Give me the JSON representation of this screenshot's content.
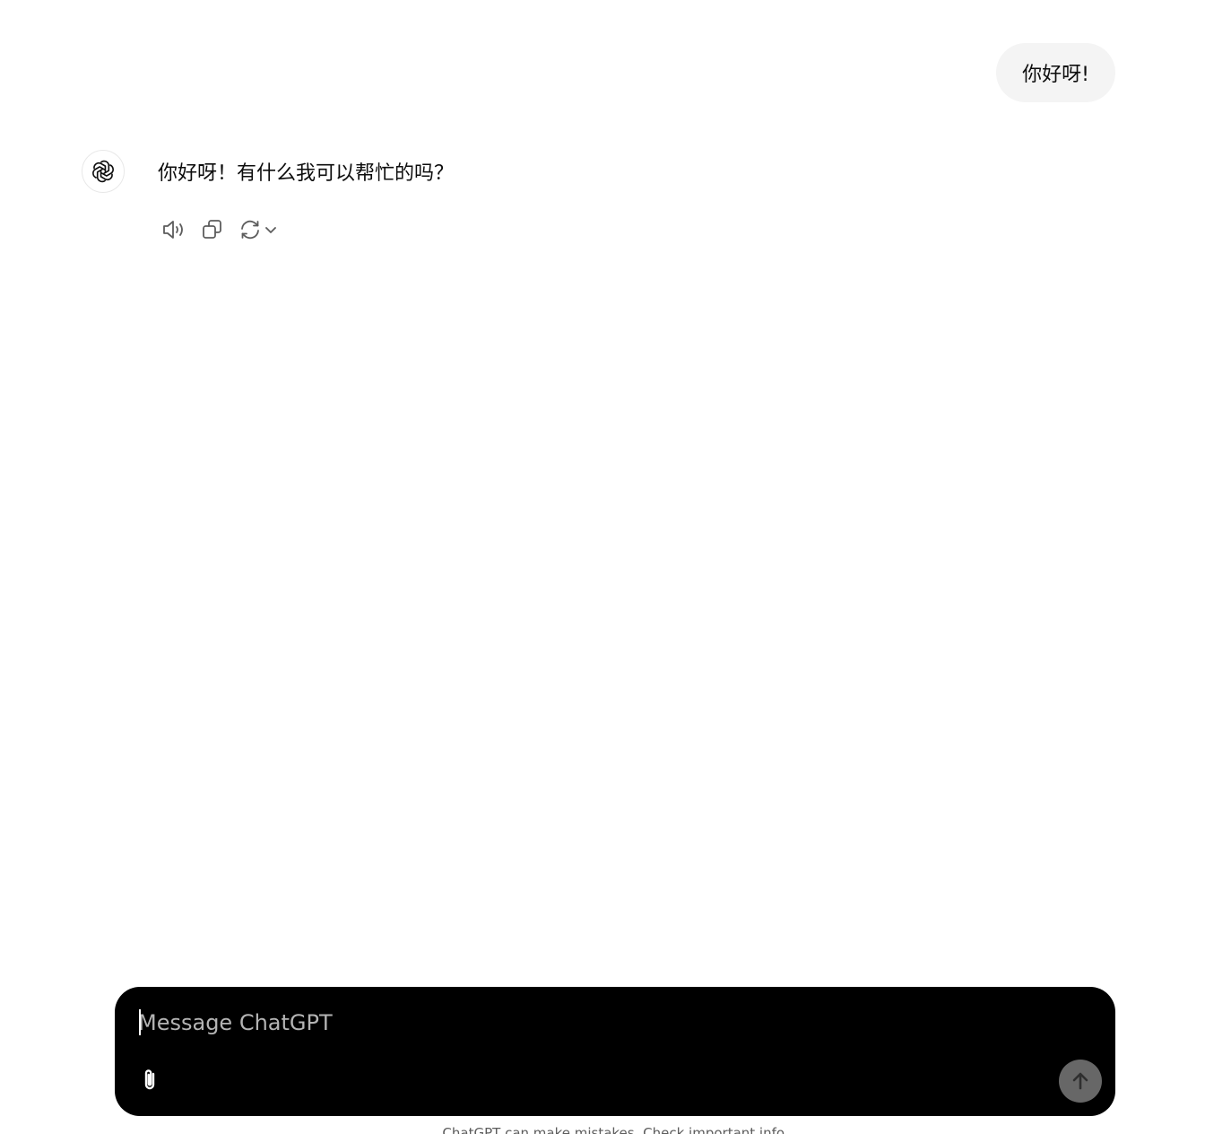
{
  "conversation": {
    "user_message": "你好呀!",
    "assistant_message": "你好呀！有什么我可以帮忙的吗？"
  },
  "actions": {
    "read_aloud_icon": "speaker-icon",
    "copy_icon": "copy-icon",
    "regenerate_icon": "refresh-icon",
    "regenerate_menu_icon": "chevron-down-icon"
  },
  "composer": {
    "placeholder": "Message ChatGPT",
    "value": "",
    "attach_icon": "paperclip-icon",
    "send_icon": "arrow-up-icon"
  },
  "footer": {
    "disclaimer": "ChatGPT can make mistakes. Check important info."
  },
  "colors": {
    "user_bubble_bg": "#f4f4f4",
    "composer_bg": "#000000",
    "send_button_bg": "#676767",
    "icon_gray": "#5d5d5d"
  }
}
